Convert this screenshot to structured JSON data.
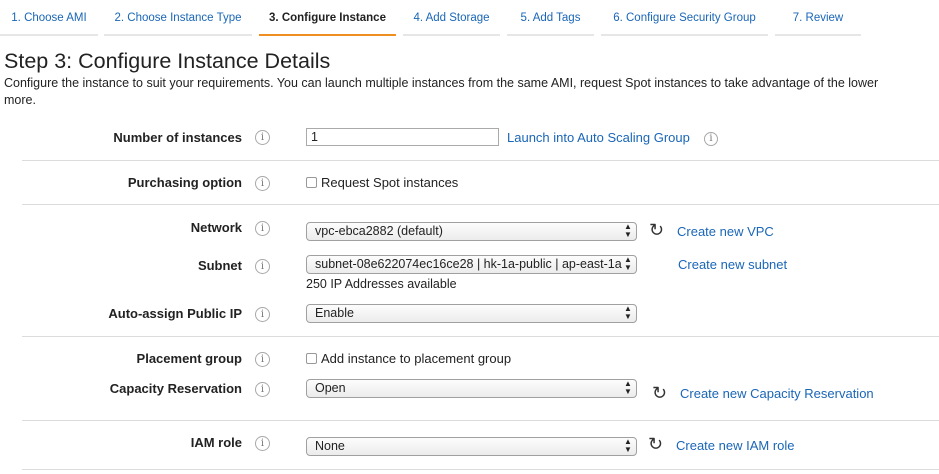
{
  "wizard": {
    "tabs": [
      {
        "label": "1. Choose AMI"
      },
      {
        "label": "2. Choose Instance Type"
      },
      {
        "label": "3. Configure Instance"
      },
      {
        "label": "4. Add Storage"
      },
      {
        "label": "5. Add Tags"
      },
      {
        "label": "6. Configure Security Group"
      },
      {
        "label": "7. Review"
      }
    ]
  },
  "page": {
    "title": "Step 3: Configure Instance Details",
    "description": "Configure the instance to suit your requirements. You can launch multiple instances from the same AMI, request Spot instances to take advantage of the lower",
    "description_cont": "more."
  },
  "form": {
    "number_of_instances": {
      "label": "Number of instances",
      "value": "1",
      "link": "Launch into Auto Scaling Group"
    },
    "purchasing_option": {
      "label": "Purchasing option",
      "checkbox_label": "Request Spot instances"
    },
    "network": {
      "label": "Network",
      "value": "vpc-ebca2882 (default)",
      "link": "Create new VPC"
    },
    "subnet": {
      "label": "Subnet",
      "value": "subnet-08e622074ec16ce28 | hk-1a-public | ap-east-1a",
      "link": "Create new subnet",
      "help": "250 IP Addresses available"
    },
    "auto_assign_ip": {
      "label": "Auto-assign Public IP",
      "value": "Enable"
    },
    "placement_group": {
      "label": "Placement group",
      "checkbox_label": "Add instance to placement group"
    },
    "capacity_reservation": {
      "label": "Capacity Reservation",
      "value": "Open",
      "link": "Create new Capacity Reservation"
    },
    "iam_role": {
      "label": "IAM role",
      "value": "None",
      "link": "Create new IAM role"
    }
  },
  "icons": {
    "info": "i",
    "refresh": "↻",
    "select_arrows": [
      "▲",
      "▼"
    ]
  },
  "colors": {
    "link": "#1a66b7",
    "active_tab_underline": "#ef8f21"
  }
}
